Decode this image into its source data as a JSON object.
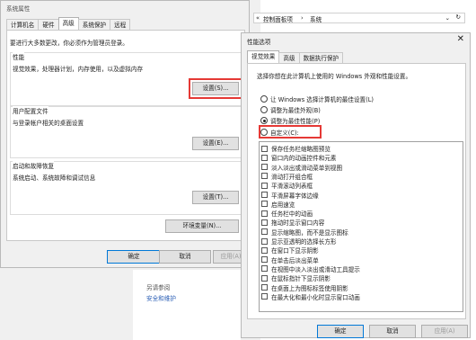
{
  "sysprops": {
    "title": "系统属性",
    "tabs": [
      "计算机名",
      "硬件",
      "高级",
      "系统保护",
      "远程"
    ],
    "admin_note": "要进行大多数更改，你必须作为管理员登录。",
    "perf": {
      "label": "性能",
      "desc": "视觉效果，处理器计划，内存使用，以及虚拟内存",
      "button": "设置(S)..."
    },
    "profile": {
      "label": "用户配置文件",
      "desc": "与登录帐户相关的桌面设置",
      "button": "设置(E)..."
    },
    "startup": {
      "label": "启动和故障恢复",
      "desc": "系统启动、系统故障和调试信息",
      "button": "设置(T)..."
    },
    "env_button": "环境变量(N)...",
    "ok": "确定",
    "cancel": "取消",
    "apply": "应用(A)"
  },
  "explorer": {
    "breadcrumb_sep": "«",
    "breadcrumb_1": "控制面板项",
    "breadcrumb_arrow": "›",
    "breadcrumb_2": "系统",
    "see_also": "另请参阅",
    "security_link": "安全和维护"
  },
  "perfopts": {
    "title": "性能选项",
    "tabs": [
      "视觉效果",
      "高级",
      "数据执行保护"
    ],
    "instruction": "选择你想在此计算机上使用的 Windows 外观和性能设置。",
    "radios": [
      "让 Windows 选择计算机的最佳设置(L)",
      "调整为最佳外观(B)",
      "调整为最佳性能(P)",
      "自定义(C):"
    ],
    "selected_radio": 2,
    "options": [
      "保存任务栏缩略图预览",
      "窗口内的动画控件和元素",
      "淡入淡出或滑动菜单到视图",
      "滑动打开组合框",
      "平滑滚动列表框",
      "平滑屏幕字体边缘",
      "启用速览",
      "任务栏中的动画",
      "拖动时显示窗口内容",
      "显示缩略图，而不是显示图标",
      "显示亚透明的选择长方形",
      "在窗口下显示阴影",
      "在单击后淡出菜单",
      "在视图中淡入淡出或滑动工具提示",
      "在鼠标指针下显示阴影",
      "在桌面上为图标标签使用阴影",
      "在最大化和最小化时显示窗口动画"
    ],
    "ok": "确定",
    "cancel": "取消",
    "apply": "应用(A)"
  },
  "icons": [
    "close-icon",
    "refresh-icon",
    "chevron-down-icon"
  ]
}
